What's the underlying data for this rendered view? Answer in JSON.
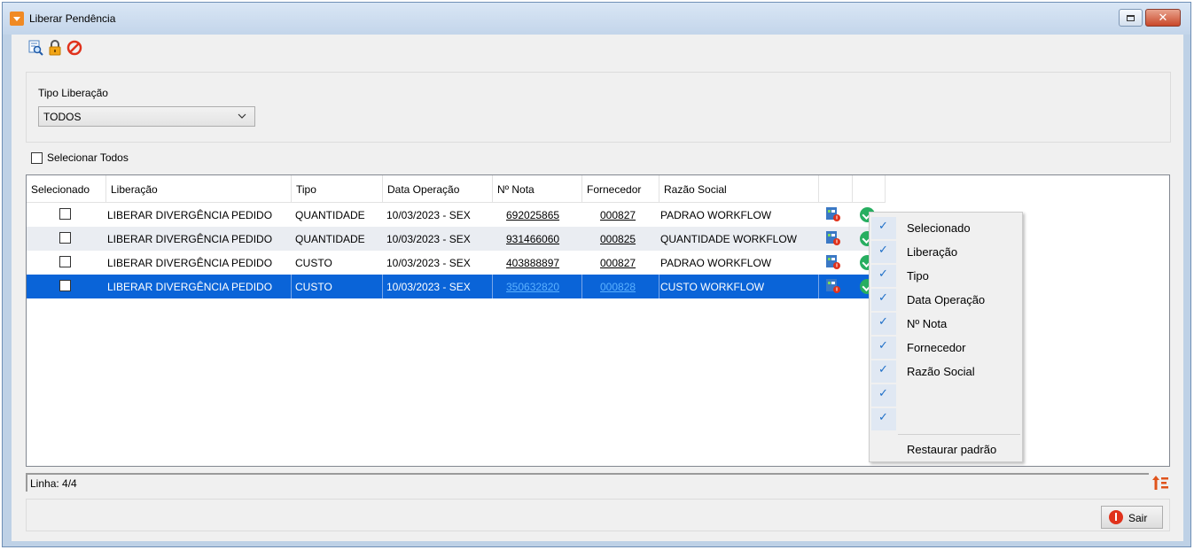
{
  "window": {
    "title": "Liberar Pendência"
  },
  "filters": {
    "tipo_label": "Tipo Liberação",
    "tipo_value": "TODOS"
  },
  "select_all_label": "Selecionar Todos",
  "grid": {
    "columns": [
      "Selecionado",
      "Liberação",
      "Tipo",
      "Data Operação",
      "Nº Nota",
      "Fornecedor",
      "Razão Social"
    ],
    "rows": [
      {
        "liberacao": "LIBERAR DIVERGÊNCIA PEDIDO",
        "tipo": "QUANTIDADE",
        "data": "10/03/2023 - SEX",
        "nota": "692025865",
        "fornecedor": "000827",
        "razao": "PADRAO WORKFLOW"
      },
      {
        "liberacao": "LIBERAR DIVERGÊNCIA PEDIDO",
        "tipo": "QUANTIDADE",
        "data": "10/03/2023 - SEX",
        "nota": "931466060",
        "fornecedor": "000825",
        "razao": "QUANTIDADE WORKFLOW"
      },
      {
        "liberacao": "LIBERAR DIVERGÊNCIA PEDIDO",
        "tipo": "CUSTO",
        "data": "10/03/2023 - SEX",
        "nota": "403888897",
        "fornecedor": "000827",
        "razao": "PADRAO WORKFLOW"
      },
      {
        "liberacao": "LIBERAR DIVERGÊNCIA PEDIDO",
        "tipo": "CUSTO",
        "data": "10/03/2023 - SEX",
        "nota": "350632820",
        "fornecedor": "000828",
        "razao": "CUSTO WORKFLOW"
      }
    ]
  },
  "context_menu": {
    "items": [
      "Selecionado",
      "Liberação",
      "Tipo",
      "Data Operação",
      "Nº Nota",
      "Fornecedor",
      "Razão Social",
      "",
      ""
    ],
    "restore_label": "Restaurar padrão"
  },
  "status": {
    "linha": "Linha: 4/4"
  },
  "buttons": {
    "sair": "Sair"
  },
  "colors": {
    "selected_row": "#0a64d8",
    "accent": "#f08a24",
    "ok": "#27ae60"
  }
}
